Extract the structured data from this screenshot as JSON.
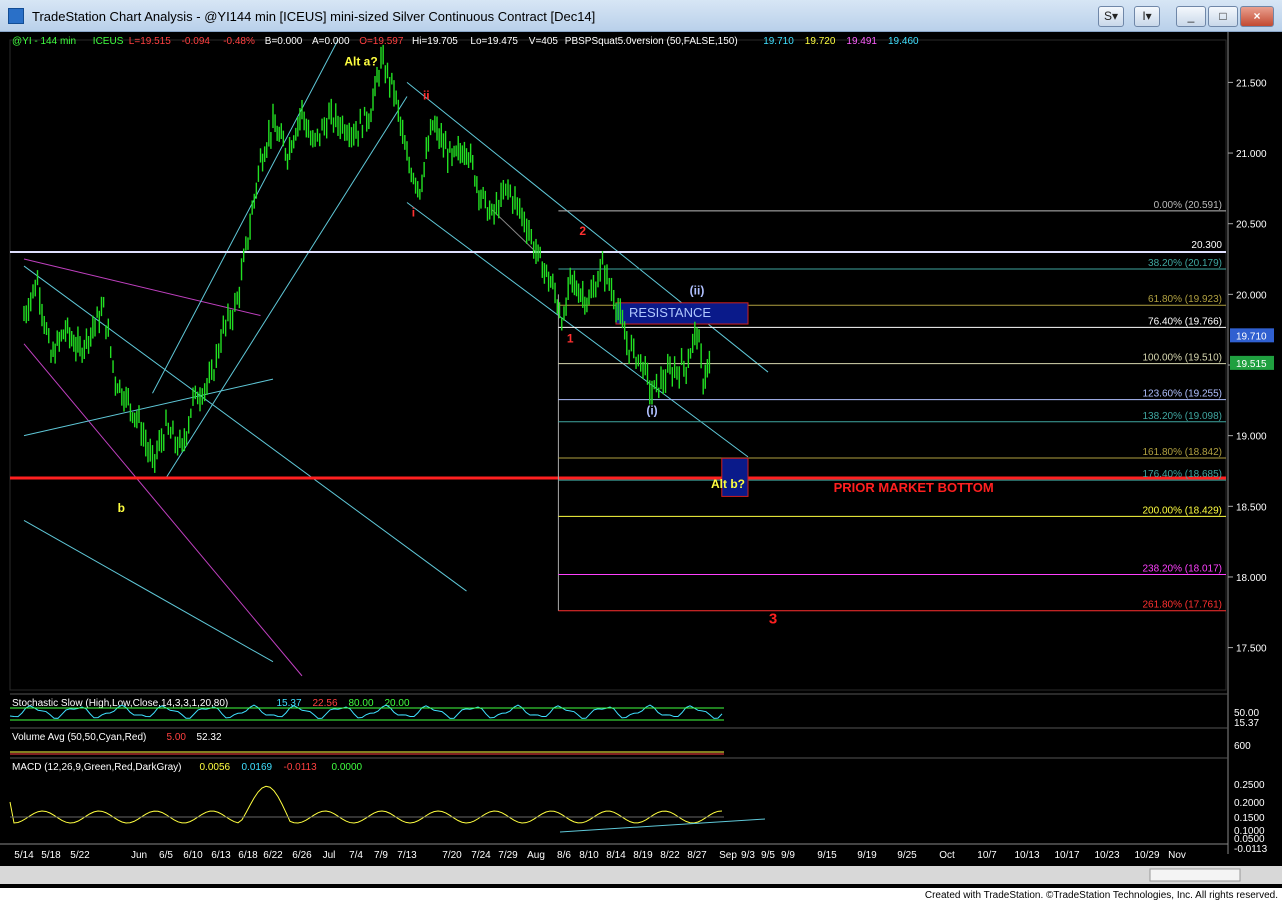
{
  "window": {
    "title": "TradeStation Chart Analysis - @YI144 min [ICEUS] mini-sized Silver Continuous Contract [Dec14]",
    "buttons": [
      "S",
      "I",
      "_",
      "□",
      "×"
    ]
  },
  "header_line": [
    {
      "text": "@YI - 144 min",
      "color": "#40ff40"
    },
    {
      "text": "ICEUS",
      "color": "#40ff40"
    },
    {
      "text": "L=19.515",
      "color": "#ff4040"
    },
    {
      "text": "-0.094",
      "color": "#ff4040"
    },
    {
      "text": "-0.48%",
      "color": "#ff4040"
    },
    {
      "text": "B=0.000",
      "color": "#ffffff"
    },
    {
      "text": "A=0.000",
      "color": "#ffffff"
    },
    {
      "text": "O=19.597",
      "color": "#ff4040"
    },
    {
      "text": "Hi=19.705",
      "color": "#ffffff"
    },
    {
      "text": "Lo=19.475",
      "color": "#ffffff"
    },
    {
      "text": "V=405",
      "color": "#ffffff"
    },
    {
      "text": "PBSPSquat5.0version (50,FALSE,150)",
      "color": "#ffffff"
    },
    {
      "text": "19.710",
      "color": "#40e0ff"
    },
    {
      "text": "19.720",
      "color": "#ffff40"
    },
    {
      "text": "19.491",
      "color": "#ff60ff"
    },
    {
      "text": "19.460",
      "color": "#40e0ff"
    }
  ],
  "chart_data": {
    "type": "line",
    "series_name": "@YI - 144 min",
    "y_axis": {
      "ylim": [
        17.2,
        21.8
      ],
      "ticks": [
        21.5,
        21.0,
        20.5,
        20.0,
        19.5,
        19.0,
        18.5,
        18.0,
        17.5
      ],
      "tick_labels": [
        "21.500",
        "21.000",
        "20.500",
        "20.000",
        "",
        "19.000",
        "18.500",
        "18.000",
        "17.500"
      ]
    },
    "x_axis": {
      "dates": [
        "5/14",
        "5/18",
        "5/22",
        "Jun",
        "6/5",
        "6/10",
        "6/13",
        "6/18",
        "6/22",
        "6/26",
        "Jul",
        "7/4",
        "7/9",
        "7/13",
        "7/20",
        "7/24",
        "7/29",
        "Aug",
        "8/6",
        "8/10",
        "8/14",
        "8/19",
        "8/22",
        "8/27",
        "Sep",
        "9/3",
        "9/5",
        "9/9",
        "9/15",
        "9/19",
        "9/25",
        "Oct",
        "10/7",
        "10/13",
        "10/17",
        "10/23",
        "10/29",
        "Nov"
      ]
    },
    "price_path": [
      {
        "x": "5/14",
        "y": 19.85
      },
      {
        "x": "5/16",
        "y": 20.1
      },
      {
        "x": "5/18",
        "y": 19.55
      },
      {
        "x": "5/20",
        "y": 19.75
      },
      {
        "x": "5/22",
        "y": 19.6
      },
      {
        "x": "5/26",
        "y": 19.9
      },
      {
        "x": "5/28",
        "y": 19.4
      },
      {
        "x": "Jun",
        "y": 19.1
      },
      {
        "x": "6/3",
        "y": 18.8
      },
      {
        "x": "6/5",
        "y": 19.05
      },
      {
        "x": "6/8",
        "y": 18.9
      },
      {
        "x": "6/10",
        "y": 19.25
      },
      {
        "x": "6/12",
        "y": 19.4
      },
      {
        "x": "6/13",
        "y": 19.7
      },
      {
        "x": "6/16",
        "y": 19.95
      },
      {
        "x": "6/18",
        "y": 20.4
      },
      {
        "x": "6/20",
        "y": 20.95
      },
      {
        "x": "6/22",
        "y": 21.2
      },
      {
        "x": "6/24",
        "y": 21.0
      },
      {
        "x": "6/26",
        "y": 21.3
      },
      {
        "x": "6/28",
        "y": 21.05
      },
      {
        "x": "Jul",
        "y": 21.25
      },
      {
        "x": "7/4",
        "y": 21.15
      },
      {
        "x": "7/7",
        "y": 21.3
      },
      {
        "x": "7/9",
        "y": 21.65
      },
      {
        "x": "7/11",
        "y": 21.45
      },
      {
        "x": "7/13",
        "y": 20.95
      },
      {
        "x": "7/15",
        "y": 20.75
      },
      {
        "x": "7/17",
        "y": 21.2
      },
      {
        "x": "7/20",
        "y": 20.95
      },
      {
        "x": "7/22",
        "y": 21.05
      },
      {
        "x": "7/24",
        "y": 20.7
      },
      {
        "x": "7/26",
        "y": 20.55
      },
      {
        "x": "7/29",
        "y": 20.75
      },
      {
        "x": "7/31",
        "y": 20.5
      },
      {
        "x": "Aug",
        "y": 20.3
      },
      {
        "x": "8/4",
        "y": 20.05
      },
      {
        "x": "8/6",
        "y": 19.8
      },
      {
        "x": "8/7",
        "y": 20.1
      },
      {
        "x": "8/10",
        "y": 19.95
      },
      {
        "x": "8/12",
        "y": 20.2
      },
      {
        "x": "8/14",
        "y": 19.95
      },
      {
        "x": "8/16",
        "y": 19.65
      },
      {
        "x": "8/19",
        "y": 19.5
      },
      {
        "x": "8/20",
        "y": 19.3
      },
      {
        "x": "8/22",
        "y": 19.45
      },
      {
        "x": "8/25",
        "y": 19.5
      },
      {
        "x": "8/27",
        "y": 19.75
      },
      {
        "x": "8/28",
        "y": 19.4
      },
      {
        "x": "8/29",
        "y": 19.52
      }
    ],
    "fib_levels": [
      {
        "label": "0.00% (20.591)",
        "price": 20.591,
        "color": "#bbbbbb"
      },
      {
        "label": "20.300",
        "price": 20.3,
        "color": "#ffffff"
      },
      {
        "label": "38.20% (20.179)",
        "price": 20.179,
        "color": "#3fa6a0"
      },
      {
        "label": "61.80% (19.923)",
        "price": 19.923,
        "color": "#b0a040"
      },
      {
        "label": "76.40% (19.766)",
        "price": 19.766,
        "color": "#ffffff"
      },
      {
        "label": "100.00% (19.510)",
        "price": 19.51,
        "color": "#d8d8b0"
      },
      {
        "label": "123.60% (19.255)",
        "price": 19.255,
        "color": "#b0c0ff"
      },
      {
        "label": "138.20% (19.098)",
        "price": 19.098,
        "color": "#3fa6a0"
      },
      {
        "label": "161.80% (18.842)",
        "price": 18.842,
        "color": "#b0a040"
      },
      {
        "label": "176.40% (18.685)",
        "price": 18.685,
        "color": "#3fa6a0"
      },
      {
        "label": "200.00% (18.429)",
        "price": 18.429,
        "color": "#ffff40"
      },
      {
        "label": "238.20% (18.017)",
        "price": 18.017,
        "color": "#ff40ff"
      },
      {
        "label": "261.80% (17.761)",
        "price": 17.761,
        "color": "#ff3030"
      }
    ],
    "price_badges": [
      {
        "label": "19.710",
        "price": 19.71,
        "color": "#3060d0"
      },
      {
        "label": "19.515",
        "price": 19.515,
        "color": "#20a040"
      }
    ],
    "annotations": [
      {
        "text": "Alt a?",
        "x": "7/5",
        "y": 21.62,
        "color": "#ffff40"
      },
      {
        "text": "ii",
        "x": "7/16",
        "y": 21.38,
        "color": "#ff3030"
      },
      {
        "text": "i",
        "x": "7/14",
        "y": 20.55,
        "color": "#ff3030"
      },
      {
        "text": "2",
        "x": "8/9",
        "y": 20.42,
        "color": "#ff3030"
      },
      {
        "text": "(ii)",
        "x": "8/27",
        "y": 20.0,
        "color": "#b0c0ff"
      },
      {
        "text": "RESISTANCE",
        "x": "8/22",
        "y": 19.84,
        "color": "#b0c8ff"
      },
      {
        "text": "1",
        "x": "8/7",
        "y": 19.66,
        "color": "#ff3030"
      },
      {
        "text": "(i)",
        "x": "8/20",
        "y": 19.15,
        "color": "#b0c0ff"
      },
      {
        "text": "Alt b?",
        "x": "9/1",
        "y": 18.63,
        "color": "#ffff40"
      },
      {
        "text": "PRIOR MARKET BOTTOM",
        "x": "9/26",
        "y": 18.6,
        "color": "#ff2020"
      },
      {
        "text": "b",
        "x": "5/29",
        "y": 18.46,
        "color": "#ffff40"
      },
      {
        "text": "3",
        "x": "9/6",
        "y": 17.67,
        "color": "#ff2020"
      }
    ],
    "zones": [
      {
        "name": "RESISTANCE",
        "from": "8/14",
        "to": "9/3",
        "y_low": 19.79,
        "y_high": 19.94
      },
      {
        "name": "Alt b?",
        "from": "8/31",
        "to": "9/3",
        "y_low": 18.57,
        "y_high": 18.84
      }
    ],
    "horizontal_lines": [
      {
        "name": "Prior market bottom",
        "price": 18.7,
        "color": "#ff2020"
      }
    ]
  },
  "indicators": {
    "stochastic": {
      "name": "Stochastic Slow (High,Low,Close,14,3,3,1,20,80)",
      "values": [
        "15.37",
        "22.56",
        "80.00",
        "20.00"
      ],
      "colors": [
        "#40e0ff",
        "#ff4040",
        "#40ff40",
        "#40ff40"
      ],
      "axis": [
        "50.00",
        "15.37"
      ]
    },
    "volume": {
      "name": "Volume Avg (50,50,Cyan,Red)",
      "values": [
        "5.00",
        "52.32"
      ],
      "colors": [
        "#ff4040",
        "#ffffff"
      ],
      "axis": [
        "600"
      ]
    },
    "macd": {
      "name": "MACD (12,26,9,Green,Red,DarkGray)",
      "values": [
        "0.0056",
        "0.0169",
        "-0.0113",
        "0.0000"
      ],
      "colors": [
        "#ffff40",
        "#40e0ff",
        "#ff4040",
        "#40ff40"
      ],
      "axis": [
        "0.2500",
        "0.2000",
        "0.1500",
        "0.1000",
        "0.0500",
        "-0.0113"
      ]
    }
  },
  "footer": {
    "text": "Created with TradeStation. ©TradeStation Technologies, Inc. All rights reserved."
  }
}
